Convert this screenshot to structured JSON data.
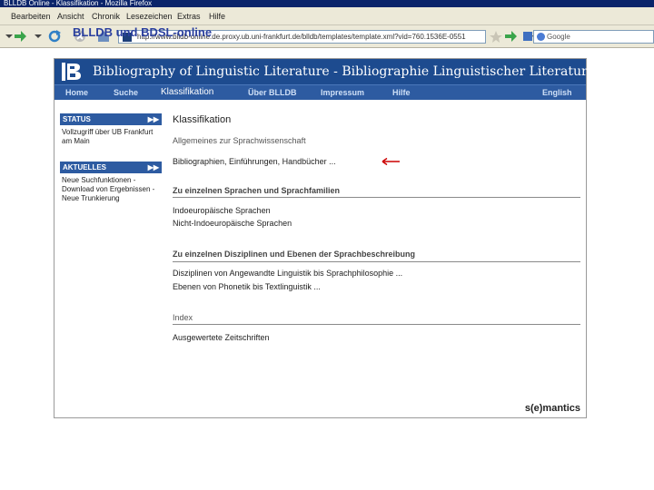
{
  "window": {
    "title": "BLLDB Online - Klassifikation - Mozilla Firefox"
  },
  "menu": [
    "Bearbeiten",
    "Ansicht",
    "Chronik",
    "Lesezeichen",
    "Extras",
    "Hilfe"
  ],
  "toolbar": {
    "url": "http://www.blldb-online.de.proxy.ub.uni-frankfurt.de/blldb/templates/template.xml?vid=760.1536E-0551",
    "search_placeholder": "Google"
  },
  "overlay_title": "BLLDB und BDSL-online",
  "site": {
    "banner_title": "Bibliography of Linguistic Literature - Bibliographie Linguistischer Literatur",
    "nav": [
      {
        "label": "Home"
      },
      {
        "label": "Suche"
      },
      {
        "label": "Klassifikation"
      },
      {
        "label": "Über BLLDB"
      },
      {
        "label": "Impressum"
      },
      {
        "label": "Hilfe"
      },
      {
        "label": "English"
      }
    ]
  },
  "sidebar": {
    "status": {
      "title": "STATUS",
      "body": "Vollzugriff über UB Frankfurt am Main"
    },
    "news": {
      "title": "AKTUELLES",
      "body": "Neue Suchfunktionen - Download von Ergebnissen - Neue Trunkierung"
    },
    "arrow": "▶▶"
  },
  "main": {
    "title": "Klassifikation",
    "general": "Allgemeines zur Sprachwissenschaft",
    "bib_link": "Bibliographien, Einführungen, Handbücher ...",
    "sec1": "Zu einzelnen Sprachen und Sprachfamilien",
    "sec1_links": [
      "Indoeuropäische Sprachen",
      "Nicht-Indoeuropäische Sprachen"
    ],
    "sec2": "Zu einzelnen Disziplinen und Ebenen der Sprachbeschreibung",
    "sec2_links": [
      "Disziplinen von Angewandte Linguistik bis Sprachphilosophie ...",
      "Ebenen von Phonetik bis Textlinguistik ..."
    ],
    "sec3": "Index",
    "sec3_link": "Ausgewertete Zeitschriften"
  },
  "footer": {
    "brand": "s(e)mantics"
  },
  "colors": {
    "banner": "#1d4b8f",
    "nav": "#2d5ba1",
    "arrow": "#cc0000"
  }
}
